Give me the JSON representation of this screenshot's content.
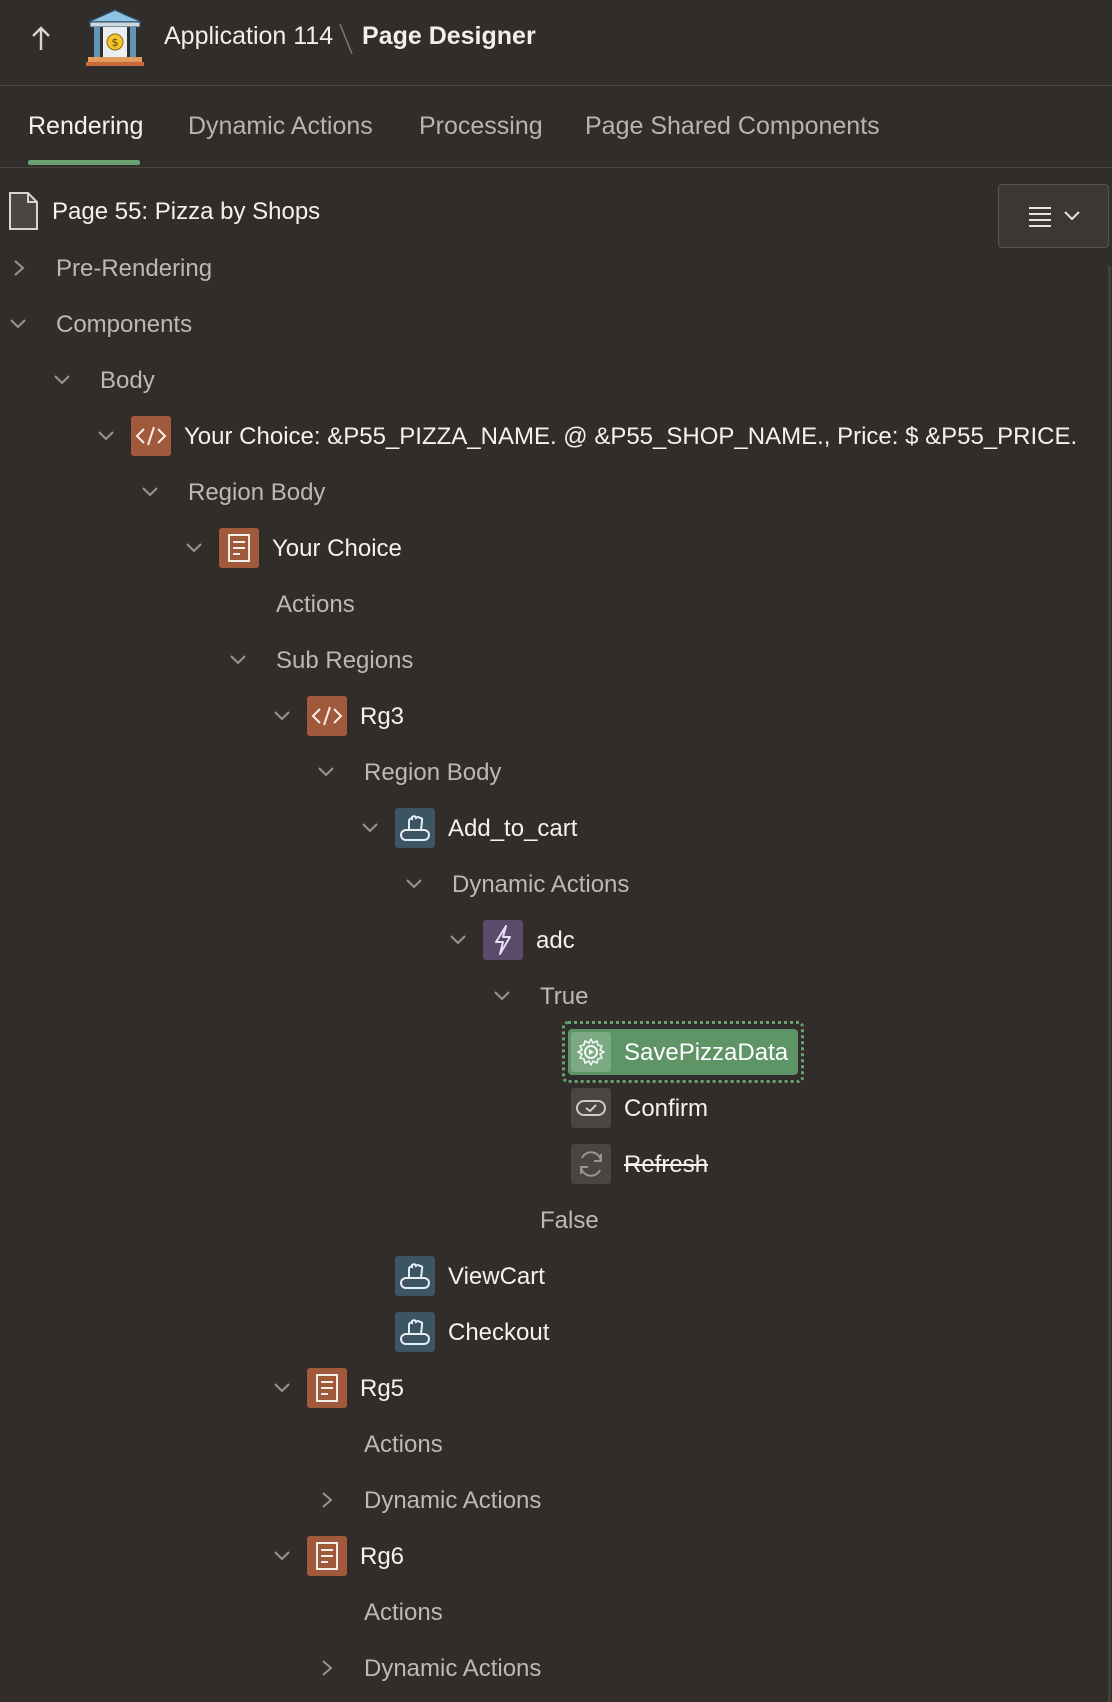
{
  "header": {
    "app_title": "Application 114",
    "page_title": "Page Designer"
  },
  "tabs": [
    {
      "label": "Rendering",
      "active": true
    },
    {
      "label": "Dynamic Actions",
      "active": false
    },
    {
      "label": "Processing",
      "active": false
    },
    {
      "label": "Page Shared Components",
      "active": false
    }
  ],
  "tree": {
    "root": "Page 55: Pizza by Shops",
    "pre_rendering": "Pre-Rendering",
    "components": "Components",
    "body": "Body",
    "main_region": "Your Choice: &P55_PIZZA_NAME. @ &P55_SHOP_NAME., Price: $ &P55_PRICE.",
    "region_body_1": "Region Body",
    "your_choice": "Your Choice",
    "actions_1": "Actions",
    "sub_regions": "Sub Regions",
    "rg3": "Rg3",
    "region_body_2": "Region Body",
    "add_to_cart": "Add_to_cart",
    "dynamic_actions_1": "Dynamic Actions",
    "adc": "adc",
    "true_label": "True",
    "save_pizza_data": "SavePizzaData",
    "confirm": "Confirm",
    "refresh": "Refresh",
    "false_label": "False",
    "view_cart": "ViewCart",
    "checkout": "Checkout",
    "rg5": "Rg5",
    "actions_2": "Actions",
    "dynamic_actions_2": "Dynamic Actions",
    "rg6": "Rg6",
    "actions_3": "Actions",
    "dynamic_actions_3": "Dynamic Actions"
  },
  "colors": {
    "background": "#312d2a",
    "accent_green": "#6aa173",
    "region_icon": "#a0593a",
    "button_icon": "#3b5563",
    "dynamic_action_icon": "#5a4a6b"
  },
  "icons": [
    "up-arrow-icon",
    "bank-logo-icon",
    "page-icon",
    "code-region-icon",
    "static-region-icon",
    "button-icon",
    "lightning-icon",
    "gear-icon",
    "confirm-icon",
    "refresh-icon",
    "menu-icon",
    "chevron-down-icon",
    "chevron-right-icon"
  ]
}
